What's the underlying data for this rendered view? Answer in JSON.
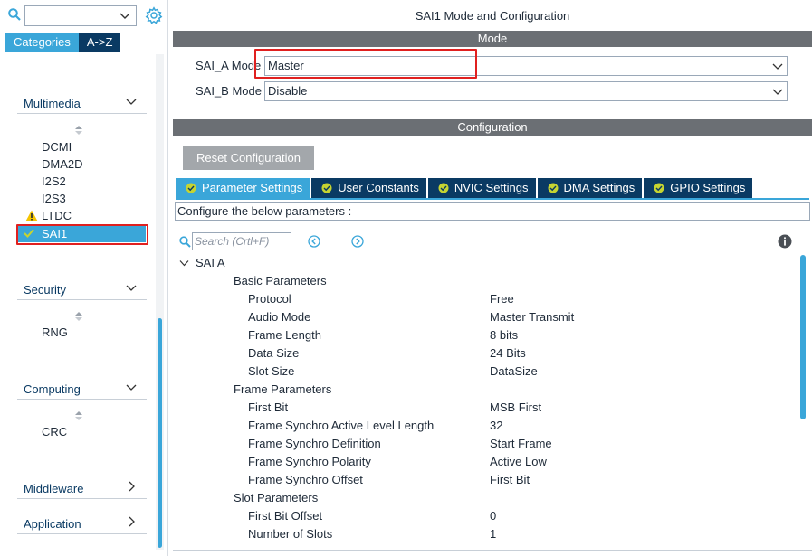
{
  "sidebar": {
    "search_value": "",
    "tabs": [
      {
        "label": "Categories",
        "active": true
      },
      {
        "label": "A->Z",
        "active": false
      }
    ],
    "sections": [
      {
        "title": "Multimedia",
        "expanded": true,
        "items": [
          "DCMI",
          "DMA2D",
          "I2S2",
          "I2S3",
          "LTDC",
          "SAI1"
        ]
      },
      {
        "title": "Security",
        "expanded": true,
        "items": [
          "RNG"
        ]
      },
      {
        "title": "Computing",
        "expanded": true,
        "items": [
          "CRC"
        ]
      },
      {
        "title": "Middleware",
        "expanded": false,
        "items": []
      },
      {
        "title": "Application",
        "expanded": false,
        "items": []
      }
    ],
    "selected_item": "SAI1",
    "warning_item": "LTDC"
  },
  "main": {
    "window_title": "SAI1 Mode and Configuration",
    "mode_bar": "Mode",
    "mode_rows": [
      {
        "label": "SAI_A Mode",
        "value": "Master"
      },
      {
        "label": "SAI_B Mode",
        "value": "Disable"
      }
    ],
    "config_bar": "Configuration",
    "reset_button": "Reset Configuration",
    "tabs": [
      {
        "label": "Parameter Settings",
        "active": true
      },
      {
        "label": "User Constants",
        "active": false
      },
      {
        "label": "NVIC Settings",
        "active": false
      },
      {
        "label": "DMA Settings",
        "active": false
      },
      {
        "label": "GPIO Settings",
        "active": false
      }
    ],
    "description": "Configure the below parameters :",
    "search_placeholder": "Search (Crtl+F)",
    "tree": {
      "root": "SAI A",
      "groups": [
        {
          "title": "Basic Parameters",
          "params": [
            {
              "name": "Protocol",
              "value": "Free"
            },
            {
              "name": "Audio Mode",
              "value": "Master Transmit"
            },
            {
              "name": "Frame Length",
              "value": "8 bits"
            },
            {
              "name": "Data Size",
              "value": "24 Bits"
            },
            {
              "name": "Slot Size",
              "value": "DataSize"
            }
          ]
        },
        {
          "title": "Frame Parameters",
          "params": [
            {
              "name": "First Bit",
              "value": "MSB First"
            },
            {
              "name": "Frame Synchro Active Level Length",
              "value": "32"
            },
            {
              "name": "Frame Synchro Definition",
              "value": "Start Frame"
            },
            {
              "name": "Frame Synchro Polarity",
              "value": "Active Low"
            },
            {
              "name": "Frame Synchro Offset",
              "value": "First Bit"
            }
          ]
        },
        {
          "title": "Slot Parameters",
          "params": [
            {
              "name": "First Bit Offset",
              "value": "0"
            },
            {
              "name": "Number of Slots",
              "value": "1"
            }
          ]
        }
      ]
    }
  },
  "colors": {
    "accent": "#3aa6d9",
    "navy": "#0a3a63",
    "bar_gray": "#6b6f74",
    "highlight_red": "#e0201f",
    "warning": "#f5c400",
    "ok_green": "#c6d431"
  }
}
